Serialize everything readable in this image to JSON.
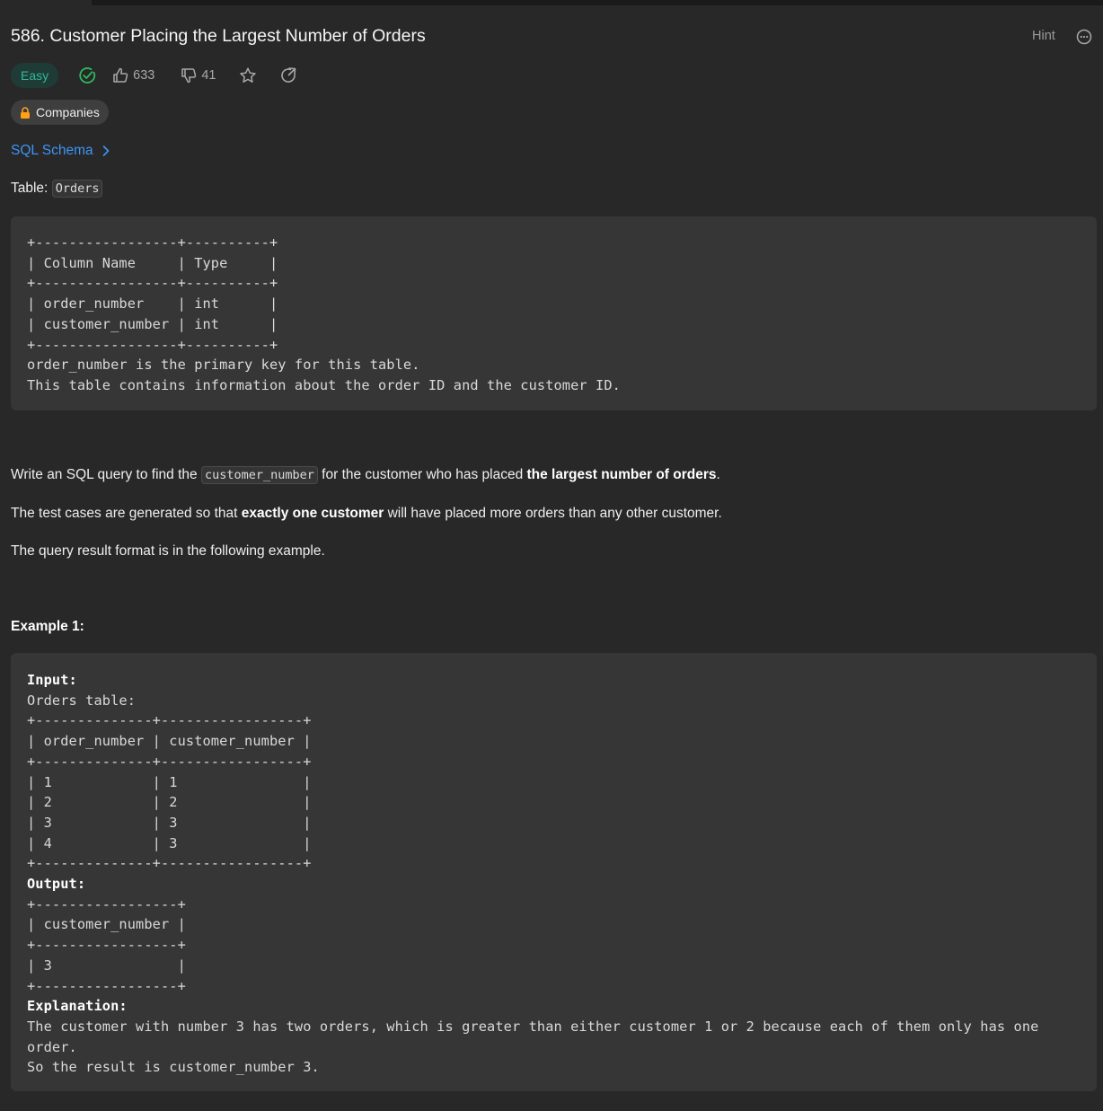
{
  "problem": {
    "title": "586. Customer Placing the Largest Number of Orders",
    "hint_label": "Hint",
    "difficulty": "Easy",
    "likes": "633",
    "dislikes": "41",
    "companies_label": "Companies",
    "schema_link": "SQL Schema",
    "table_label": "Table:",
    "table_name": "Orders"
  },
  "schema_block": {
    "text": "+-----------------+----------+\n| Column Name     | Type     |\n+-----------------+----------+\n| order_number    | int      |\n| customer_number | int      |\n+-----------------+----------+\norder_number is the primary key for this table.\nThis table contains information about the order ID and the customer ID."
  },
  "description": {
    "p1_pre": "Write an SQL query to find the ",
    "p1_code": "customer_number",
    "p1_mid": " for the customer who has placed ",
    "p1_bold": "the largest number of orders",
    "p1_post": ".",
    "p2_pre": "The test cases are generated so that ",
    "p2_bold": "exactly one customer",
    "p2_post": " will have placed more orders than any other customer.",
    "p3": "The query result format is in the following example."
  },
  "example": {
    "heading": "Example 1:",
    "input_label": "Input:",
    "input_text": "Orders table:\n+--------------+-----------------+\n| order_number | customer_number |\n+--------------+-----------------+\n| 1            | 1               |\n| 2            | 2               |\n| 3            | 3               |\n| 4            | 3               |\n+--------------+-----------------+",
    "output_label": "Output:",
    "output_text": "+-----------------+\n| customer_number |\n+-----------------+\n| 3               |\n+-----------------+",
    "explanation_label": "Explanation:",
    "explanation_text": "The customer with number 3 has two orders, which is greater than either customer 1 or 2 because each of them only has one\norder.\nSo the result is customer_number 3."
  },
  "colors": {
    "background": "#282828",
    "easy_text": "#33b79a",
    "link": "#3d95f5",
    "solved_check": "#2cbb5d",
    "lock": "#ffa116"
  },
  "icons": [
    "solved-check-icon",
    "thumbs-up-icon",
    "thumbs-down-icon",
    "star-icon",
    "share-icon",
    "lock-icon",
    "chevron-right-icon",
    "more-icon"
  ]
}
